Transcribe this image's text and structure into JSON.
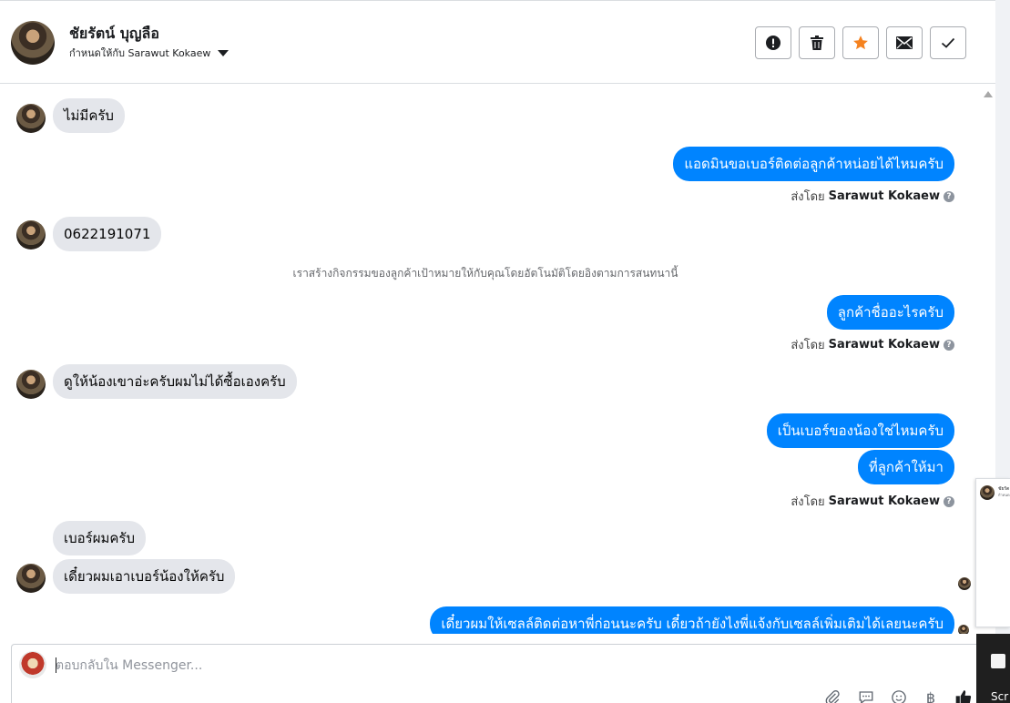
{
  "header": {
    "contact_name": "ชัยรัตน์ บุญลือ",
    "assigned_to": "กำหนดให้กับ Sarawut Kokaew",
    "actions": [
      {
        "name": "spam",
        "icon": "exclamation-icon"
      },
      {
        "name": "delete",
        "icon": "trash-icon"
      },
      {
        "name": "star",
        "icon": "star-icon",
        "color": "#f5821f"
      },
      {
        "name": "mark-unread",
        "icon": "envelope-icon"
      },
      {
        "name": "done",
        "icon": "check-icon"
      }
    ]
  },
  "colors": {
    "outgoing_bubble": "#0084ff",
    "incoming_bubble": "#e4e6eb",
    "star": "#f5821f"
  },
  "messages": {
    "m1": "ไม่มีครับ",
    "m2": "แอดมินขอเบอร์ติดต่อลูกค้าหน่อยได้ไหมครับ",
    "m3": "0622191071",
    "system_note": "เราสร้างกิจกรรมของลูกค้าเป้าหมายให้กับคุณโดยอัตโนมัติโดยอิงตามการสนทนานี้",
    "m4": "ลูกค้าชื่ออะไรครับ",
    "m5": "ดูให้น้องเขาอ่ะครับผมไม่ได้ซื้อเองครับ",
    "m6": "เป็นเบอร์ของน้องใช่ไหมครับ",
    "m7": "ที่ลูกค้าให้มา",
    "m8": "เบอร์ผมครับ",
    "m9": "เดี๋ยวผมเอาเบอร์น้องให้ครับ",
    "m10": "เดี๋ยวผมให้เซลล์ติดต่อหาพี่ก่อนนะครับ เดี๋ยวถ้ายังไงพี่แจ้งกับเซลล์เพิ่มเติมได้เลยนะครับ"
  },
  "sent_by": {
    "prefix": "ส่งโดย",
    "agent": "Sarawut Kokaew"
  },
  "composer": {
    "placeholder": "ตอบกลับใน Messenger...",
    "tools": [
      "attachment-icon",
      "saved-reply-icon",
      "emoji-icon",
      "baht-icon",
      "like-icon"
    ],
    "baht_symbol": "฿"
  },
  "mini_window": {
    "name": "ชัยรัต",
    "sub": "กำหนด"
  },
  "taskbar": {
    "label": "Scr"
  }
}
